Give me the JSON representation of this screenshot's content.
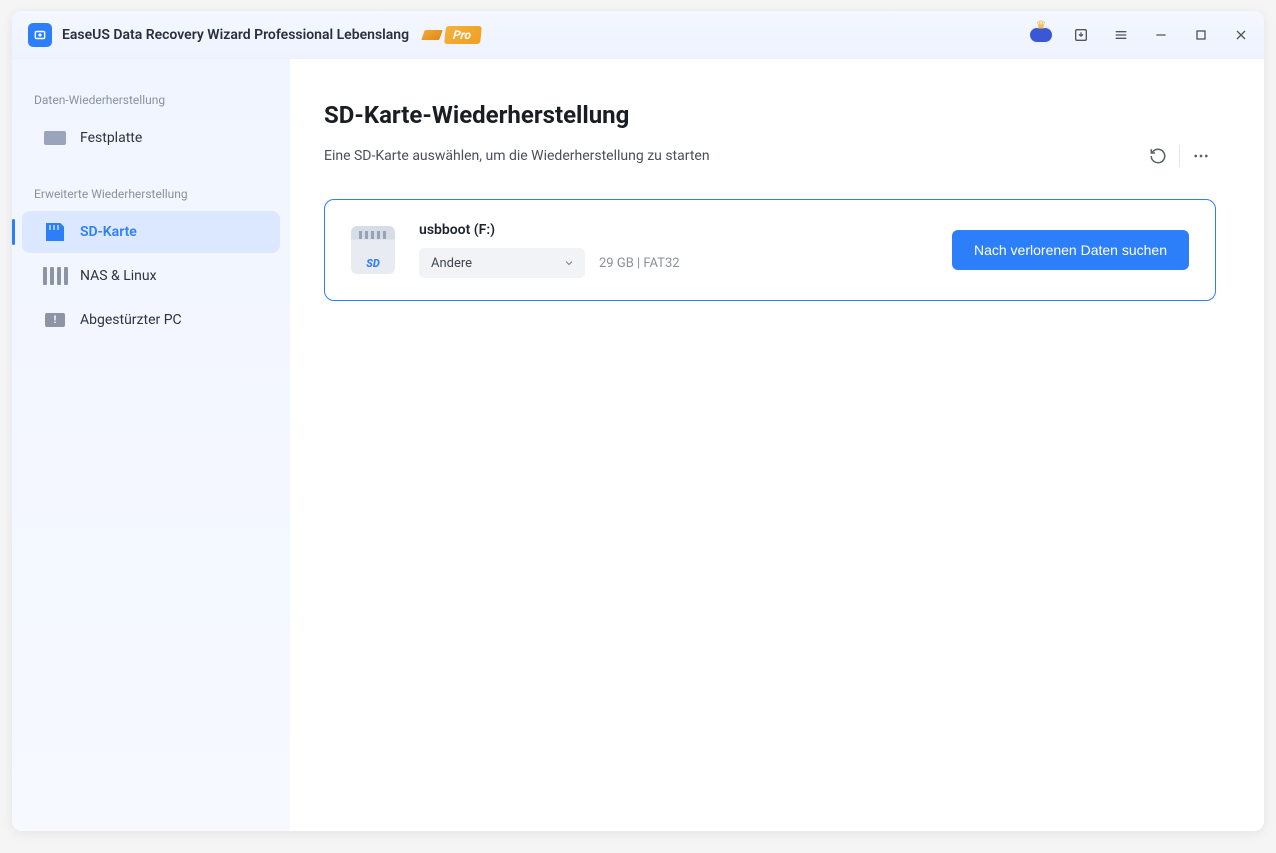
{
  "titlebar": {
    "app_title": "EaseUS Data Recovery Wizard Professional Lebenslang",
    "pro_label": "Pro"
  },
  "sidebar": {
    "sections": {
      "recovery": "Daten-Wiederherstellung",
      "advanced": "Erweiterte Wiederherstellung"
    },
    "items": {
      "hdd": "Festplatte",
      "sd": "SD-Karte",
      "nas": "NAS & Linux",
      "crashed": "Abgestürzter PC"
    }
  },
  "main": {
    "title": "SD-Karte-Wiederherstellung",
    "subtitle": "Eine SD-Karte auswählen, um die Wiederherstellung zu starten"
  },
  "device": {
    "name": "usbboot (F:)",
    "type_selected": "Andere",
    "meta": "29 GB | FAT32",
    "scan_label": "Nach verlorenen Daten suchen",
    "sd_label": "SD"
  }
}
